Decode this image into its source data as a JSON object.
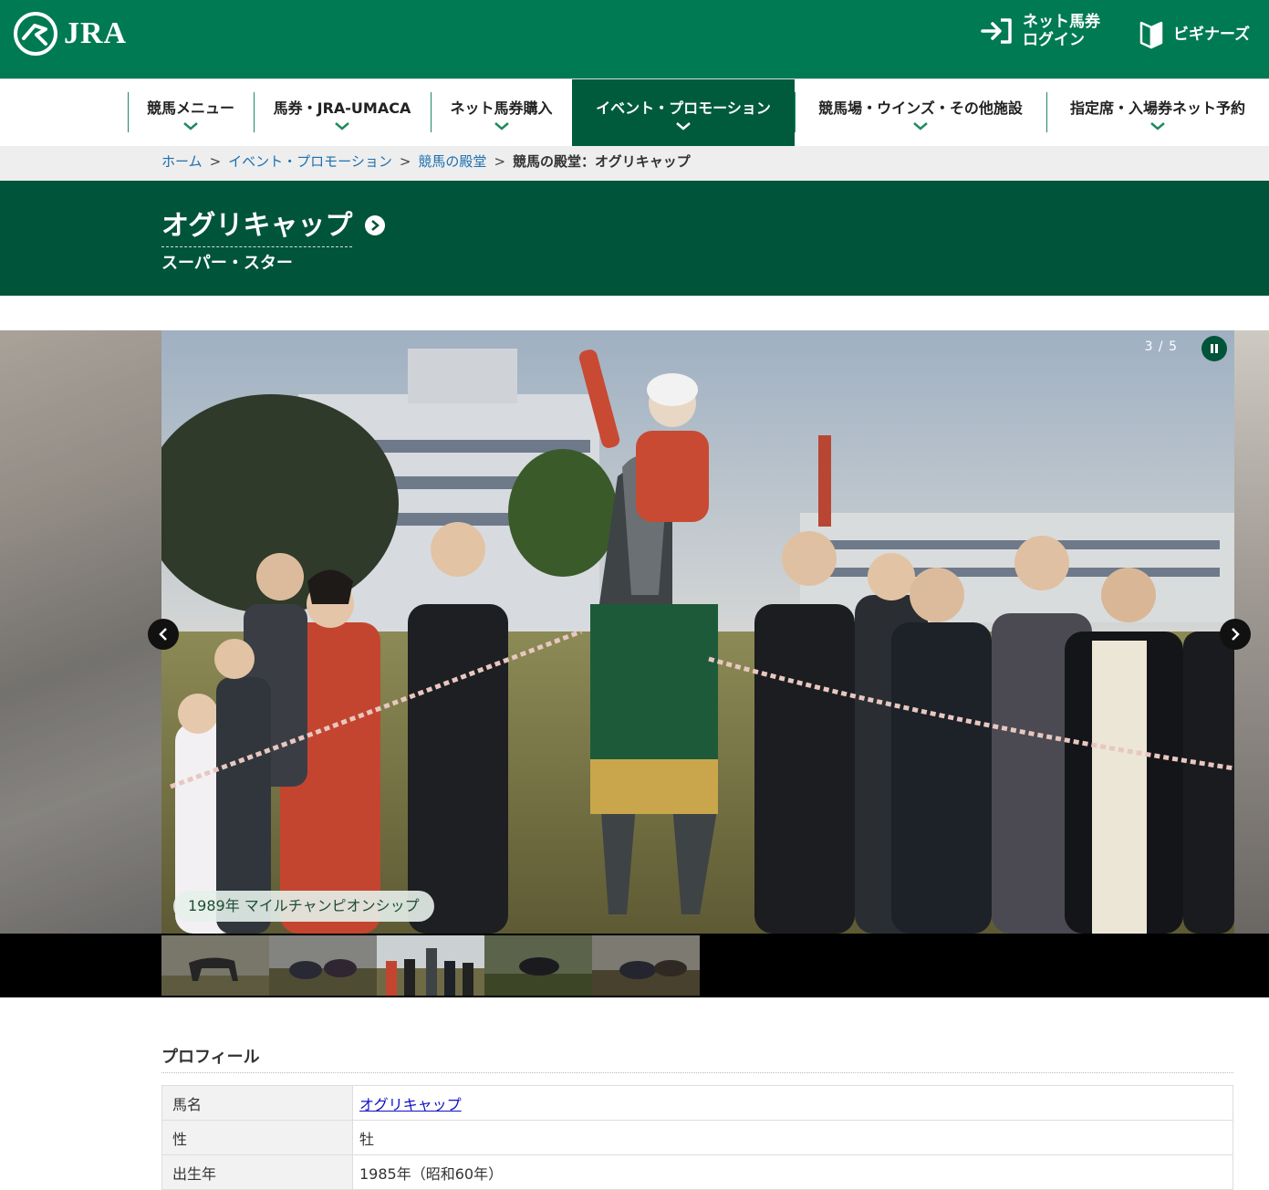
{
  "header": {
    "logo_text": "JRA",
    "login_label_1": "ネット馬券",
    "login_label_2": "ログイン",
    "beginner_label": "ビギナーズ",
    "brand_color": "#007a52"
  },
  "nav": {
    "items": [
      {
        "label": "競馬メニュー"
      },
      {
        "label": "馬券・JRA-UMACA"
      },
      {
        "label": "ネット馬券購入"
      },
      {
        "label": "イベント・プロモーション"
      },
      {
        "label": "競馬場・ウインズ・その他施設"
      },
      {
        "label": "指定席・入場券ネット予約"
      }
    ],
    "active_index": 3
  },
  "breadcrumb": {
    "items": [
      "ホーム",
      "イベント・プロモーション",
      "競馬の殿堂"
    ],
    "current": "競馬の殿堂：オグリキャップ",
    "separator": ">"
  },
  "title": {
    "horse_name": "オグリキャップ",
    "subtitle": "スーパー・スター"
  },
  "slider": {
    "counter": "3 / 5",
    "caption": "1989年 マイルチャンピオンシップ",
    "current_index": 3,
    "total": 5,
    "thumbnail_count": 5
  },
  "profile": {
    "heading": "プロフィール",
    "rows": [
      {
        "key": "馬名",
        "value": "オグリキャップ"
      },
      {
        "key": "性",
        "value": "牡"
      },
      {
        "key": "出生年",
        "value": "1985年（昭和60年）"
      }
    ]
  }
}
